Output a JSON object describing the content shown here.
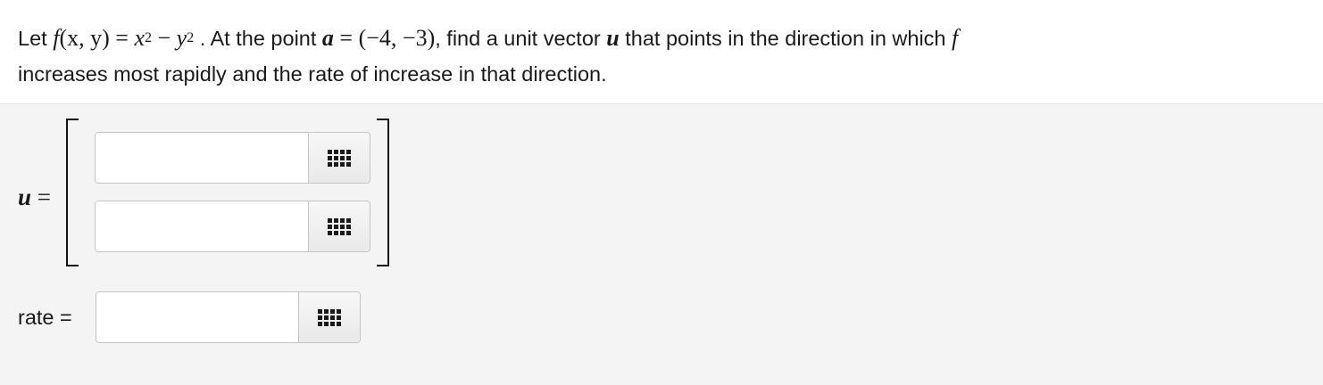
{
  "question": {
    "line1": {
      "t1": "Let ",
      "func": "f",
      "args": "(x, y)",
      "eq": " = ",
      "x": "x",
      "exp1": "2",
      "minus": " − ",
      "y": "y",
      "exp2": "2",
      "t2": " . At the point ",
      "a": "a",
      "point": " = (−4, −3)",
      "t3": ", find a unit vector ",
      "u": "u",
      "t4": " that points in the direction in which ",
      "f2": "f"
    },
    "line2": "increases most rapidly and the rate of increase in that direction."
  },
  "answer": {
    "u_var": "u",
    "u_eq": " =",
    "u_component1_value": "",
    "u_component2_value": "",
    "rate_label": "rate =",
    "rate_value": ""
  },
  "icons": {
    "palette": "grid-icon"
  }
}
